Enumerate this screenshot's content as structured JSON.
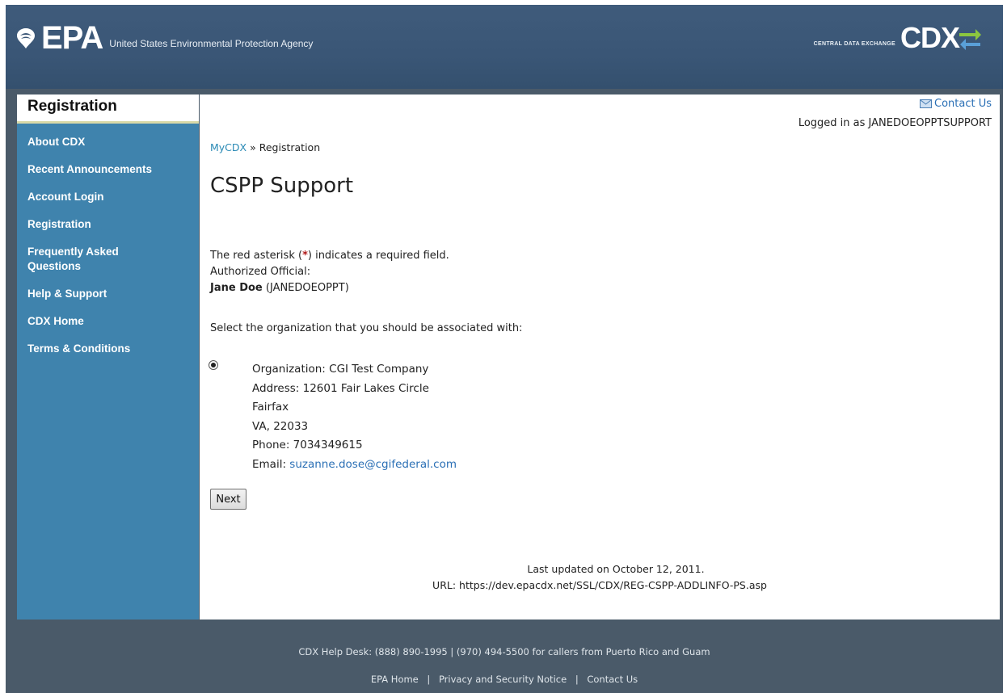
{
  "header": {
    "epa_wordmark": "EPA",
    "agency_name": "United States Environmental Protection Agency",
    "cdx_subtitle": "CENTRAL DATA EXCHANGE",
    "cdx_wordmark": "CDX"
  },
  "sidebar": {
    "title": "Registration",
    "items": [
      {
        "label": "About CDX"
      },
      {
        "label": "Recent Announcements"
      },
      {
        "label": "Account Login"
      },
      {
        "label": "Registration"
      },
      {
        "label": "Frequently Asked Questions"
      },
      {
        "label": "Help & Support"
      },
      {
        "label": "CDX Home"
      },
      {
        "label": "Terms & Conditions"
      }
    ]
  },
  "topbar": {
    "contact_label": "Contact Us",
    "logged_in": "Logged in as JANEDOEOPPTSUPPORT"
  },
  "breadcrumb": {
    "home": "MyCDX",
    "separator": "»",
    "current": "Registration"
  },
  "page": {
    "title": "CSPP Support",
    "required_note_pre": "The red asterisk (",
    "required_asterisk": "*",
    "required_note_post": ") indicates a required field.",
    "authorized_label": "Authorized Official:",
    "official_name": "Jane Doe",
    "official_id": "(JANEDOEOPPT)",
    "select_prompt": "Select the organization that you should be associated with:",
    "organization": {
      "selected": true,
      "name": "Organization: CGI Test Company",
      "address": "Address: 12601 Fair Lakes Circle",
      "city": "Fairfax",
      "state_zip": "VA, 22033",
      "phone": "Phone: 7034349615",
      "email_label": "Email: ",
      "email": "suzanne.dose@cgifederal.com"
    },
    "next_button": "Next",
    "last_updated": "Last updated on October 12, 2011.",
    "url_line": "URL: https://dev.epacdx.net/SSL/CDX/REG-CSPP-ADDLINFO-PS.asp"
  },
  "footer": {
    "helpdesk": "CDX Help Desk: (888) 890-1995 | (970) 494-5500 for callers from Puerto Rico and Guam",
    "links": [
      "EPA Home",
      "Privacy and Security Notice",
      "Contact Us"
    ],
    "link_separator": "|"
  },
  "colors": {
    "header_bg": "#3a5676",
    "sidebar_bg": "#3f83ad",
    "footer_bg": "#4a5a69",
    "link": "#2a6fb5",
    "asterisk": "#b01a1a"
  }
}
